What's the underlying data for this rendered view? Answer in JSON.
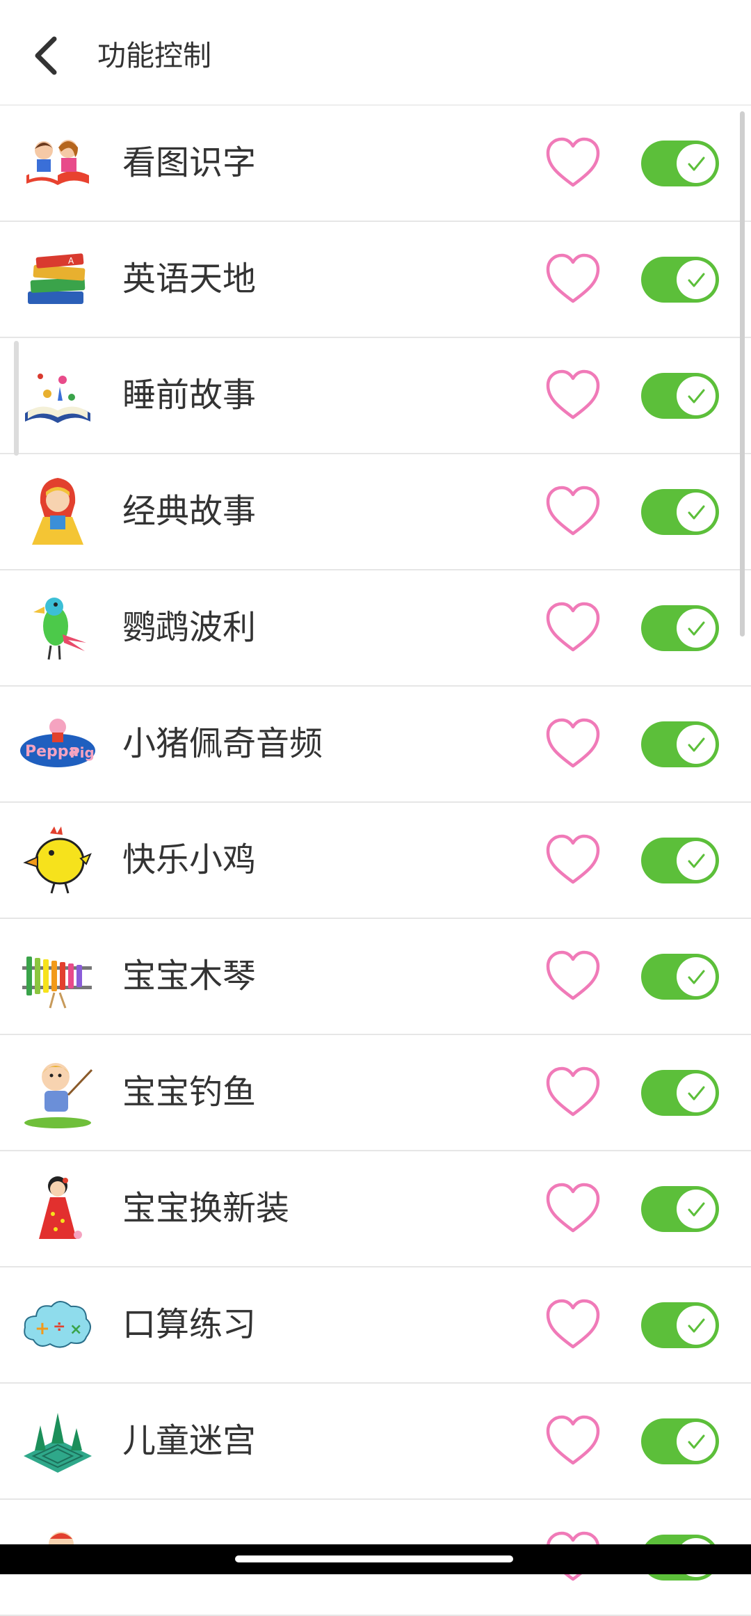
{
  "header": {
    "title": "功能控制"
  },
  "items": [
    {
      "label": "看图识字",
      "icon": "kids-reading-book-icon",
      "favorite": false,
      "enabled": true
    },
    {
      "label": "英语天地",
      "icon": "stacked-books-icon",
      "favorite": false,
      "enabled": true
    },
    {
      "label": "睡前故事",
      "icon": "storybook-icon",
      "favorite": false,
      "enabled": true
    },
    {
      "label": "经典故事",
      "icon": "red-riding-hood-icon",
      "favorite": false,
      "enabled": true
    },
    {
      "label": "鹦鹉波利",
      "icon": "parrot-icon",
      "favorite": false,
      "enabled": true
    },
    {
      "label": "小猪佩奇音频",
      "icon": "peppa-pig-icon",
      "favorite": false,
      "enabled": true
    },
    {
      "label": "快乐小鸡",
      "icon": "chick-icon",
      "favorite": false,
      "enabled": true
    },
    {
      "label": "宝宝木琴",
      "icon": "xylophone-icon",
      "favorite": false,
      "enabled": true
    },
    {
      "label": "宝宝钓鱼",
      "icon": "boy-fishing-icon",
      "favorite": false,
      "enabled": true
    },
    {
      "label": "宝宝换新装",
      "icon": "dress-up-girl-icon",
      "favorite": false,
      "enabled": true
    },
    {
      "label": "口算练习",
      "icon": "math-cloud-icon",
      "favorite": false,
      "enabled": true
    },
    {
      "label": "儿童迷宫",
      "icon": "maze-icon",
      "favorite": false,
      "enabled": true
    },
    {
      "label": "",
      "icon": "partial-item-icon",
      "favorite": false,
      "enabled": true
    }
  ],
  "colors": {
    "toggle_on": "#5cbf3a",
    "heart_outline": "#f07ab8",
    "text": "#333333"
  }
}
